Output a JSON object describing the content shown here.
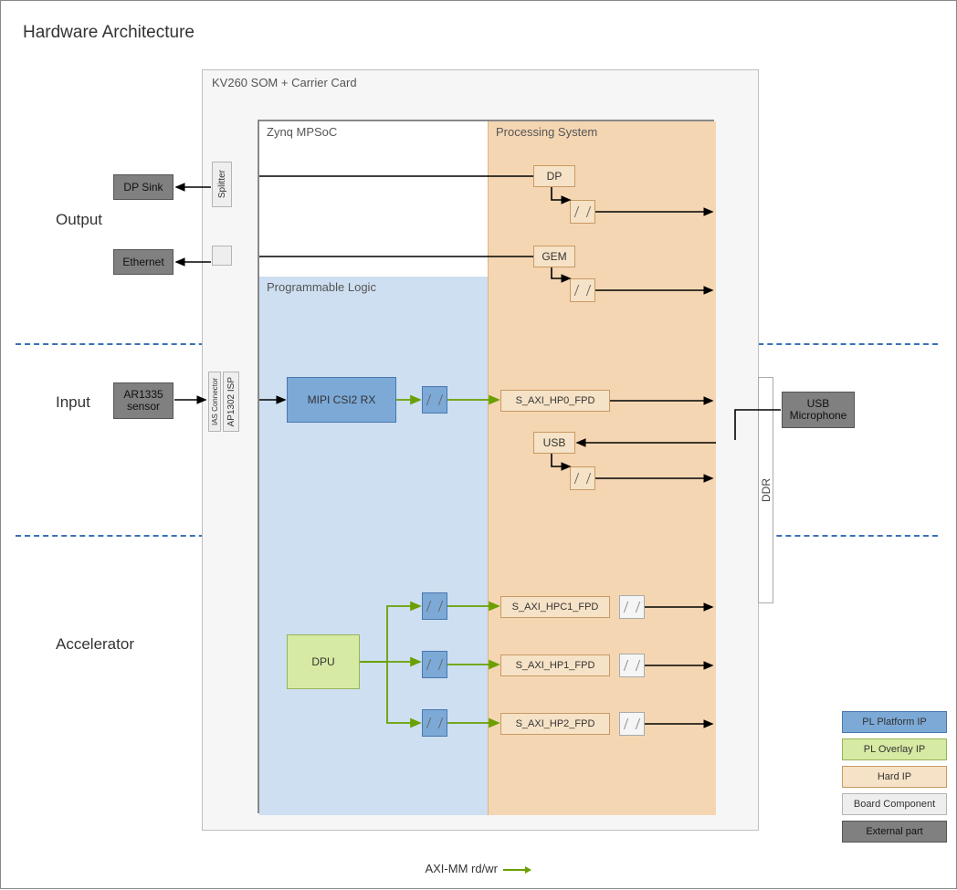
{
  "title": "Hardware Architecture",
  "sections": {
    "output": "Output",
    "input": "Input",
    "accelerator": "Accelerator"
  },
  "som_label": "KV260 SOM + Carrier Card",
  "mpsoc_label": "Zynq MPSoC",
  "ps_label": "Processing System",
  "pl_label": "Programmable Logic",
  "ddr_label": "DDR",
  "ext": {
    "dp_sink": "DP Sink",
    "ethernet": "Ethernet",
    "ar1335": "AR1335\nsensor",
    "usb_mic": "USB\nMicrophone"
  },
  "board": {
    "splitter": "Splitter",
    "ias": "IAS Connector",
    "isp": "AP1302 ISP"
  },
  "ps_blocks": {
    "dp": "DP",
    "gem": "GEM",
    "usb": "USB",
    "hp0": "S_AXI_HP0_FPD",
    "hpc1": "S_AXI_HPC1_FPD",
    "hp1": "S_AXI_HP1_FPD",
    "hp2": "S_AXI_HP2_FPD"
  },
  "pl_blocks": {
    "mipi": "MIPI CSI2 RX",
    "dpu": "DPU"
  },
  "legend": {
    "plplat": "PL Platform IP",
    "ploverlay": "PL Overlay IP",
    "hardip": "Hard IP",
    "board": "Board Component",
    "ext": "External part"
  },
  "footer": "AXI-MM rd/wr",
  "colors": {
    "hardip": "#f6e2c6",
    "platip": "#7ca9d6",
    "overlayip": "#d7eaa3",
    "board": "#eeeeee",
    "ext": "#808080",
    "axi": "#6aa000"
  }
}
